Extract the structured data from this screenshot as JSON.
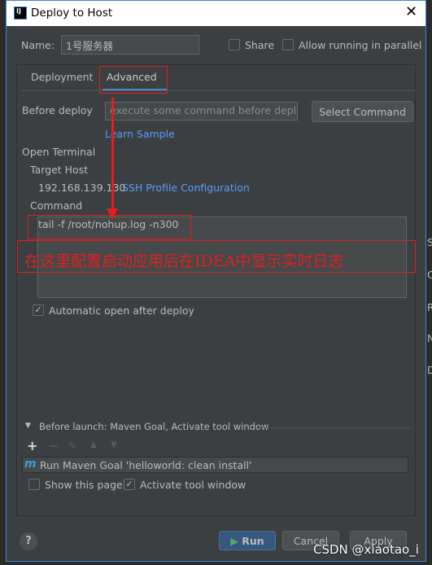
{
  "window": {
    "title": "Deploy to Host",
    "close_icon": "close-icon"
  },
  "name_label": "Name:",
  "name_value": "1号服务器",
  "share_label": "Share",
  "share_checked": false,
  "parallel_label": "Allow running in parallel",
  "parallel_checked": false,
  "tabs": [
    {
      "label": "Deployment",
      "active": false
    },
    {
      "label": "Advanced",
      "active": true
    }
  ],
  "before_deploy": {
    "label": "Before deploy",
    "placeholder": "execute some command before deploy",
    "select_button": "Select Command",
    "learn_link": "Learn Sample"
  },
  "open_terminal": {
    "label": "Open Terminal",
    "target_host_label": "Target Host",
    "host": "192.168.139.130",
    "ssh_link": "SSH Profile Configuration",
    "command_label": "Command",
    "command_value": "tail -f /root/nohup.log -n300"
  },
  "annotation": "在这里配置启动应用后在IDEA中显示实时日志",
  "auto_open": {
    "label": "Automatic open after deploy",
    "checked": true
  },
  "before_launch": {
    "header": "Before launch: Maven Goal, Activate tool window",
    "task": "Run Maven Goal 'helloworld: clean install'",
    "show_page": "Show this page",
    "show_page_checked": false,
    "activate": "Activate tool window",
    "activate_checked": true
  },
  "buttons": {
    "run": "Run",
    "cancel": "Cancel",
    "apply": "Apply",
    "help": "?"
  },
  "watermark": "CSDN @xiaotao_i",
  "background_letters": [
    "S",
    "C",
    "R",
    "N",
    "D"
  ],
  "colors": {
    "accent": "#4a88c7",
    "annotation": "#e02020",
    "link": "#589df6"
  }
}
